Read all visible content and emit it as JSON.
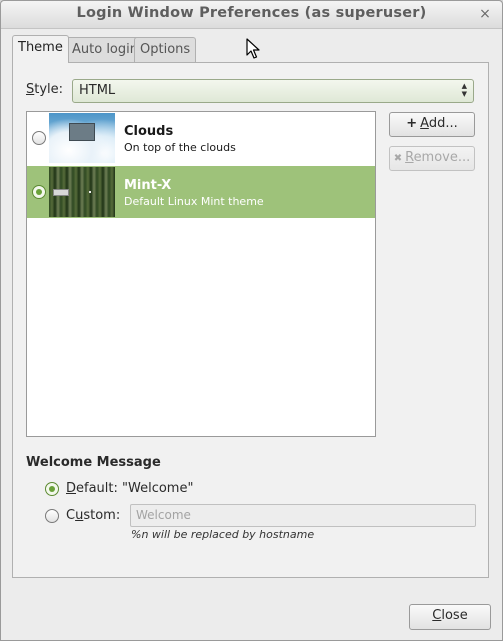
{
  "window": {
    "title": "Login Window Preferences (as superuser)",
    "close_glyph": "×"
  },
  "tabs": [
    {
      "label": "Theme",
      "active": true
    },
    {
      "label": "Auto login",
      "active": false
    },
    {
      "label": "Options",
      "active": false
    }
  ],
  "style": {
    "label_underlined": "S",
    "label_rest": "tyle:",
    "value": "HTML"
  },
  "themes": [
    {
      "name": "Clouds",
      "description": "On top of the clouds",
      "selected": false
    },
    {
      "name": "Mint-X",
      "description": "Default Linux Mint theme",
      "selected": true
    }
  ],
  "buttons": {
    "add": {
      "icon": "+",
      "underlined": "A",
      "rest": "dd..."
    },
    "remove": {
      "icon": "✖",
      "underlined": "R",
      "rest": "emove..."
    },
    "close": {
      "underlined": "C",
      "rest": "lose"
    }
  },
  "welcome": {
    "title": "Welcome Message",
    "default_underlined": "D",
    "default_rest": "efault: \"Welcome\"",
    "custom_prefix": "C",
    "custom_underlined": "u",
    "custom_rest": "stom:",
    "custom_placeholder": "Welcome",
    "hint": "%n will be replaced by hostname"
  },
  "colors": {
    "selection": "#9ec27a",
    "radio_checked": "#6aa13a"
  },
  "icons": {
    "add": "plus-icon",
    "remove": "x-icon",
    "close": "close-icon",
    "cursor": "mouse-pointer-icon"
  }
}
